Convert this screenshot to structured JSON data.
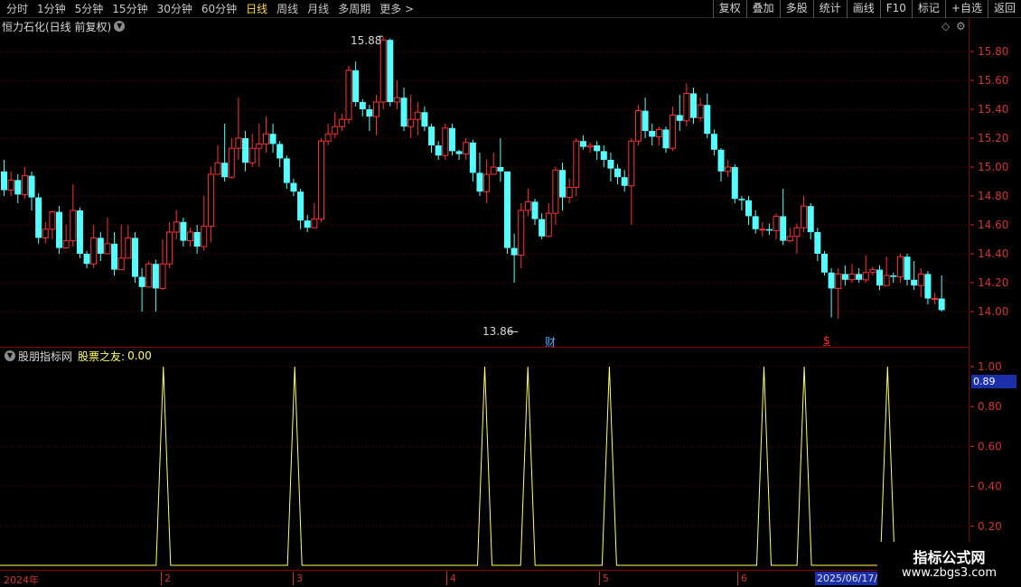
{
  "toolbar": {
    "periods": [
      "分时",
      "1分钟",
      "5分钟",
      "15分钟",
      "30分钟",
      "60分钟",
      "日线",
      "周线",
      "月线",
      "多周期",
      "更多 >"
    ],
    "active_index": 6,
    "actions": [
      "复权",
      "叠加",
      "多股",
      "统计",
      "画线",
      "F10",
      "标记",
      "+自选",
      "返回"
    ]
  },
  "main_panel": {
    "title": "恒力石化(日线 前复权)",
    "high_label": "15.88",
    "low_label": "13.86",
    "event_marker_cai": "财",
    "event_marker_s": "$"
  },
  "price_axis": {
    "labels": [
      "15.80",
      "15.60",
      "15.40",
      "15.20",
      "15.00",
      "14.80",
      "14.60",
      "14.40",
      "14.20",
      "14.00"
    ]
  },
  "indicator_panel": {
    "source": "股朋指标网",
    "name": "股票之友:",
    "value": "0.00",
    "current_tag": "0.89",
    "axis_labels": [
      "1.00",
      "0.80",
      "0.60",
      "0.40",
      "0.20"
    ]
  },
  "date_axis": {
    "year": "2024年",
    "months": [
      "2",
      "3",
      "4",
      "5",
      "6"
    ],
    "cursor_date": "2025/06/17/"
  },
  "watermark": {
    "title": "指标公式网",
    "url": "www.zbgs3.com"
  },
  "colors": {
    "up": "#ff3232",
    "down": "#54ffff",
    "indicator_line": "#ffff66",
    "panel_border": "#8b0000",
    "axis_text": "#d23232",
    "active_period": "#ffd54a"
  },
  "chart_data": {
    "type": "candlestick",
    "y_axis": {
      "range": [
        13.86,
        15.88
      ],
      "ticks": [
        14.0,
        14.2,
        14.4,
        14.6,
        14.8,
        15.0,
        15.2,
        15.4,
        15.6,
        15.8
      ]
    },
    "high": 15.88,
    "low": 13.86,
    "candles": [
      [
        14.97,
        14.84,
        15.05,
        14.8
      ],
      [
        14.84,
        14.91,
        14.97,
        14.8
      ],
      [
        14.91,
        14.81,
        14.95,
        14.75
      ],
      [
        14.81,
        14.94,
        15.0,
        14.78
      ],
      [
        14.94,
        14.79,
        14.97,
        14.7
      ],
      [
        14.79,
        14.51,
        14.82,
        14.47
      ],
      [
        14.51,
        14.57,
        14.62,
        14.47
      ],
      [
        14.57,
        14.69,
        14.7,
        14.5
      ],
      [
        14.69,
        14.44,
        14.73,
        14.4
      ],
      [
        14.44,
        14.49,
        14.6,
        14.45
      ],
      [
        14.49,
        14.7,
        14.88,
        14.45
      ],
      [
        14.7,
        14.4,
        14.72,
        14.37
      ],
      [
        14.4,
        14.33,
        14.42,
        14.3
      ],
      [
        14.33,
        14.51,
        14.6,
        14.3
      ],
      [
        14.51,
        14.4,
        14.55,
        14.35
      ],
      [
        14.4,
        14.47,
        14.65,
        14.45
      ],
      [
        14.47,
        14.29,
        14.55,
        14.25
      ],
      [
        14.29,
        14.37,
        14.6,
        14.3
      ],
      [
        14.37,
        14.51,
        14.6,
        14.38
      ],
      [
        14.51,
        14.24,
        14.55,
        14.2
      ],
      [
        14.24,
        14.17,
        14.3,
        14.0
      ],
      [
        14.17,
        14.33,
        14.35,
        14.2
      ],
      [
        14.33,
        14.16,
        14.36,
        14.0
      ],
      [
        14.16,
        14.33,
        14.5,
        14.15
      ],
      [
        14.33,
        14.55,
        14.62,
        14.3
      ],
      [
        14.55,
        14.62,
        14.7,
        14.5
      ],
      [
        14.62,
        14.49,
        14.65,
        14.45
      ],
      [
        14.49,
        14.55,
        14.58,
        14.45
      ],
      [
        14.55,
        14.45,
        14.6,
        14.4
      ],
      [
        14.45,
        14.59,
        14.8,
        14.42
      ],
      [
        14.59,
        14.95,
        15.0,
        14.48
      ],
      [
        14.95,
        15.03,
        15.15,
        14.95
      ],
      [
        15.03,
        14.93,
        15.3,
        14.9
      ],
      [
        14.93,
        15.13,
        15.2,
        14.92
      ],
      [
        15.13,
        15.2,
        15.48,
        15.05
      ],
      [
        15.2,
        15.03,
        15.25,
        14.97
      ],
      [
        15.03,
        15.13,
        15.23,
        15.0
      ],
      [
        15.13,
        15.16,
        15.3,
        15.0
      ],
      [
        15.16,
        15.23,
        15.35,
        15.1
      ],
      [
        15.23,
        15.16,
        15.3,
        15.1
      ],
      [
        15.16,
        15.06,
        15.18,
        15.0
      ],
      [
        15.06,
        14.89,
        15.08,
        14.85
      ],
      [
        14.89,
        14.83,
        14.92,
        14.8
      ],
      [
        14.83,
        14.63,
        14.85,
        14.57
      ],
      [
        14.63,
        14.58,
        14.67,
        14.55
      ],
      [
        14.58,
        14.64,
        14.75,
        14.62
      ],
      [
        14.64,
        15.18,
        15.2,
        14.62
      ],
      [
        15.18,
        15.23,
        15.3,
        15.15
      ],
      [
        15.23,
        15.28,
        15.38,
        15.2
      ],
      [
        15.28,
        15.33,
        15.37,
        15.25
      ],
      [
        15.33,
        15.67,
        15.7,
        15.3
      ],
      [
        15.67,
        15.45,
        15.73,
        15.42
      ],
      [
        15.45,
        15.4,
        15.47,
        15.35
      ],
      [
        15.4,
        15.35,
        15.43,
        15.25
      ],
      [
        15.35,
        15.45,
        15.5,
        15.22
      ],
      [
        15.45,
        15.88,
        15.9,
        15.4
      ],
      [
        15.88,
        15.45,
        15.89,
        15.42
      ],
      [
        15.45,
        15.48,
        15.6,
        15.4
      ],
      [
        15.48,
        15.28,
        15.55,
        15.25
      ],
      [
        15.28,
        15.33,
        15.5,
        15.2
      ],
      [
        15.33,
        15.38,
        15.45,
        15.22
      ],
      [
        15.38,
        15.28,
        15.42,
        15.25
      ],
      [
        15.28,
        15.15,
        15.3,
        15.1
      ],
      [
        15.15,
        15.08,
        15.18,
        15.05
      ],
      [
        15.08,
        15.27,
        15.3,
        15.05
      ],
      [
        15.27,
        15.11,
        15.3,
        15.08
      ],
      [
        15.11,
        15.09,
        15.12,
        15.05
      ],
      [
        15.09,
        15.17,
        15.2,
        15.05
      ],
      [
        15.17,
        14.96,
        15.19,
        14.9
      ],
      [
        14.96,
        14.83,
        15.1,
        14.8
      ],
      [
        14.83,
        14.95,
        15.05,
        14.75
      ],
      [
        14.95,
        15.0,
        15.1,
        14.96
      ],
      [
        15.0,
        14.97,
        15.2,
        14.9
      ],
      [
        14.97,
        14.44,
        14.77,
        14.4
      ],
      [
        14.44,
        14.39,
        14.54,
        14.2
      ],
      [
        14.39,
        14.7,
        14.75,
        14.3
      ],
      [
        14.7,
        14.76,
        14.85,
        14.66
      ],
      [
        14.76,
        14.64,
        14.78,
        14.6
      ],
      [
        14.64,
        14.52,
        14.68,
        14.5
      ],
      [
        14.52,
        14.68,
        14.75,
        14.55
      ],
      [
        14.68,
        14.98,
        15.0,
        14.6
      ],
      [
        14.98,
        14.79,
        15.03,
        14.7
      ],
      [
        14.79,
        14.86,
        14.92,
        14.75
      ],
      [
        14.86,
        15.18,
        15.2,
        14.8
      ],
      [
        15.18,
        15.14,
        15.22,
        15.12
      ],
      [
        15.14,
        15.15,
        15.17,
        15.1
      ],
      [
        15.15,
        15.11,
        15.18,
        15.05
      ],
      [
        15.11,
        15.05,
        15.15,
        15.0
      ],
      [
        15.05,
        14.99,
        15.1,
        14.9
      ],
      [
        14.99,
        14.93,
        15.02,
        14.88
      ],
      [
        14.93,
        14.87,
        14.98,
        14.83
      ],
      [
        14.87,
        15.18,
        15.2,
        14.6
      ],
      [
        15.18,
        15.39,
        15.43,
        15.15
      ],
      [
        15.39,
        15.25,
        15.48,
        15.2
      ],
      [
        15.25,
        15.21,
        15.3,
        15.15
      ],
      [
        15.21,
        15.26,
        15.28,
        15.15
      ],
      [
        15.26,
        15.13,
        15.28,
        15.1
      ],
      [
        15.13,
        15.36,
        15.42,
        15.11
      ],
      [
        15.36,
        15.32,
        15.5,
        15.25
      ],
      [
        15.32,
        15.51,
        15.58,
        15.28
      ],
      [
        15.51,
        15.34,
        15.55,
        15.3
      ],
      [
        15.34,
        15.43,
        15.48,
        15.32
      ],
      [
        15.43,
        15.23,
        15.51,
        15.2
      ],
      [
        15.23,
        15.12,
        15.26,
        15.08
      ],
      [
        15.12,
        14.97,
        15.13,
        14.9
      ],
      [
        14.97,
        15.0,
        15.05,
        14.93
      ],
      [
        15.0,
        14.78,
        15.02,
        14.75
      ],
      [
        14.78,
        14.77,
        14.8,
        14.7
      ],
      [
        14.77,
        14.66,
        14.8,
        14.6
      ],
      [
        14.66,
        14.57,
        14.7,
        14.54
      ],
      [
        14.57,
        14.57,
        14.62,
        14.52
      ],
      [
        14.57,
        14.56,
        14.61,
        14.53
      ],
      [
        14.56,
        14.66,
        14.68,
        14.5
      ],
      [
        14.66,
        14.49,
        14.85,
        14.46
      ],
      [
        14.49,
        14.52,
        14.58,
        14.48
      ],
      [
        14.52,
        14.58,
        14.61,
        14.4
      ],
      [
        14.58,
        14.73,
        14.8,
        14.55
      ],
      [
        14.73,
        14.55,
        14.75,
        14.5
      ],
      [
        14.55,
        14.4,
        14.58,
        14.35
      ],
      [
        14.4,
        14.27,
        14.42,
        14.25
      ],
      [
        14.27,
        14.16,
        14.3,
        13.96
      ],
      [
        14.16,
        14.26,
        14.3,
        13.95
      ],
      [
        14.26,
        14.22,
        14.32,
        14.18
      ],
      [
        14.22,
        14.26,
        14.33,
        14.2
      ],
      [
        14.26,
        14.22,
        14.3,
        14.2
      ],
      [
        14.22,
        14.27,
        14.39,
        14.2
      ],
      [
        14.27,
        14.29,
        14.31,
        14.25
      ],
      [
        14.29,
        14.18,
        14.32,
        14.15
      ],
      [
        14.18,
        14.25,
        14.38,
        14.18
      ],
      [
        14.25,
        14.24,
        14.27,
        14.2
      ],
      [
        14.24,
        14.38,
        14.4,
        14.2
      ],
      [
        14.38,
        14.22,
        14.4,
        14.18
      ],
      [
        14.22,
        14.18,
        14.35,
        14.15
      ],
      [
        14.18,
        14.26,
        14.3,
        14.1
      ],
      [
        14.26,
        14.09,
        14.28,
        14.05
      ],
      [
        14.09,
        14.09,
        14.13,
        14.05
      ],
      [
        14.09,
        14.01,
        14.25,
        14.0
      ]
    ],
    "indicator": {
      "name": "股票之友",
      "value": 0.0,
      "range": [
        0,
        1
      ],
      "ticks": [
        0.2,
        0.4,
        0.6,
        0.8,
        1.0
      ],
      "spike_positions": [
        0.1685,
        0.304,
        0.5,
        0.5445,
        0.6285,
        0.788,
        0.8295,
        0.9155
      ]
    }
  }
}
